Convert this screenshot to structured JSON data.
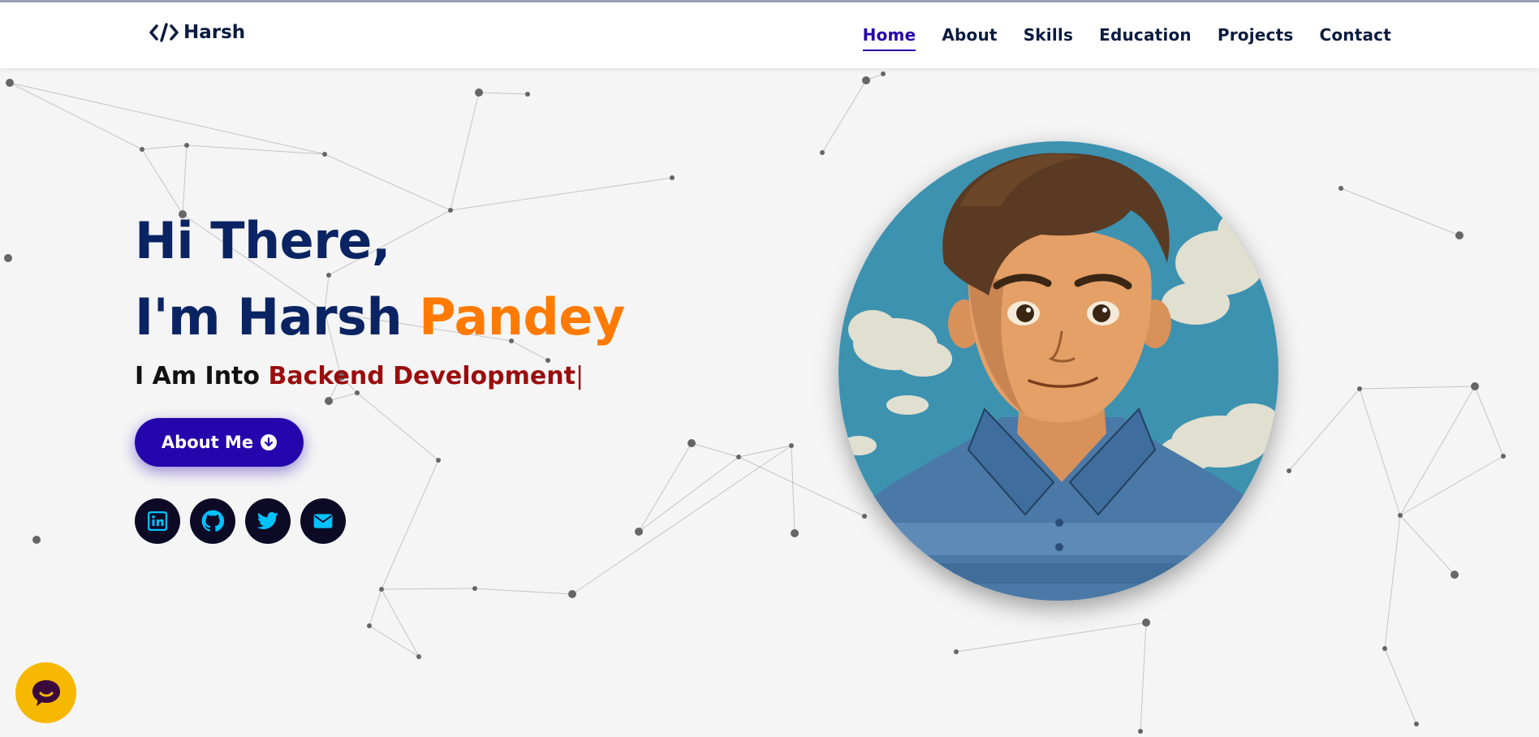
{
  "brand": {
    "logo_icon": "code-icon",
    "name": "Harsh"
  },
  "nav": {
    "items": [
      {
        "label": "Home",
        "active": true
      },
      {
        "label": "About",
        "active": false
      },
      {
        "label": "Skills",
        "active": false
      },
      {
        "label": "Education",
        "active": false
      },
      {
        "label": "Projects",
        "active": false
      },
      {
        "label": "Contact",
        "active": false
      }
    ]
  },
  "hero": {
    "greeting": "Hi There,",
    "intro_prefix": "I'm Harsh ",
    "intro_accent": "Pandey",
    "typed_prefix": "I Am Into ",
    "typed_text": "Backend Development",
    "typed_cursor": "|",
    "button_label": "About Me",
    "button_icon": "arrow-circle-down-icon"
  },
  "socials": [
    {
      "name": "linkedin",
      "icon": "linkedin-icon"
    },
    {
      "name": "github",
      "icon": "github-icon"
    },
    {
      "name": "twitter",
      "icon": "twitter-icon"
    },
    {
      "name": "email",
      "icon": "envelope-icon"
    }
  ],
  "avatar": {
    "description_icon": "avatar-illustration"
  },
  "chat_widget": {
    "icon": "chat-bubble-icon"
  },
  "colors": {
    "nav_text": "#0b1b3f",
    "nav_active": "#2506ad",
    "heading": "#0a2463",
    "accent_orange": "#ff7a00",
    "typed_red": "#9b0d0d",
    "button_bg": "#2506ad",
    "social_bg": "#0d0a26",
    "social_icon": "#00c2ff",
    "chat_bg": "#f6b800",
    "page_bg": "#f5f5f5"
  }
}
